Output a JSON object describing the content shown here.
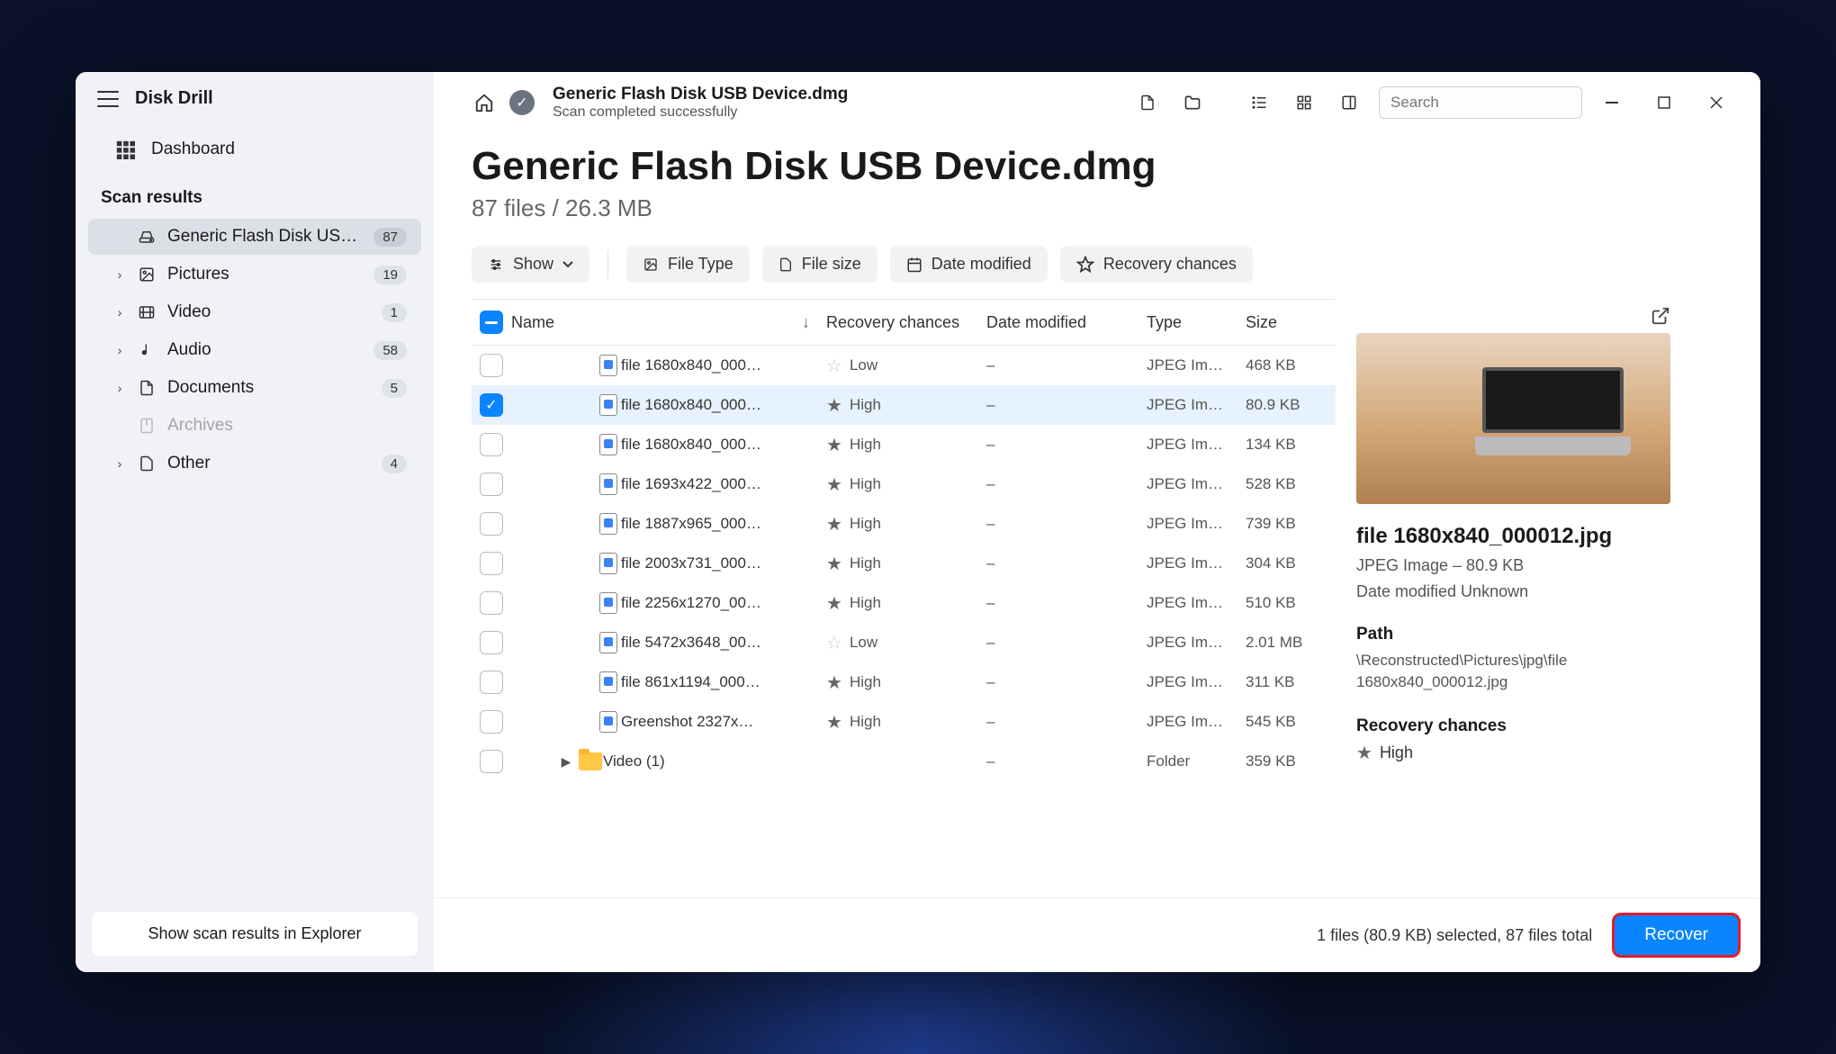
{
  "app_name": "Disk Drill",
  "sidebar": {
    "dashboard": "Dashboard",
    "section": "Scan results",
    "items": [
      {
        "label": "Generic Flash Disk USB D…",
        "badge": "87",
        "active": true,
        "icon": "drive",
        "chev": ""
      },
      {
        "label": "Pictures",
        "badge": "19",
        "icon": "pictures",
        "chev": "›"
      },
      {
        "label": "Video",
        "badge": "1",
        "icon": "video",
        "chev": "›"
      },
      {
        "label": "Audio",
        "badge": "58",
        "icon": "audio",
        "chev": "›"
      },
      {
        "label": "Documents",
        "badge": "5",
        "icon": "documents",
        "chev": "›"
      },
      {
        "label": "Archives",
        "badge": "",
        "icon": "archives",
        "chev": "",
        "disabled": true
      },
      {
        "label": "Other",
        "badge": "4",
        "icon": "other",
        "chev": "›"
      }
    ],
    "footer_btn": "Show scan results in Explorer"
  },
  "topbar": {
    "title": "Generic Flash Disk USB Device.dmg",
    "subtitle": "Scan completed successfully",
    "search_placeholder": "Search"
  },
  "heading": {
    "title": "Generic Flash Disk USB Device.dmg",
    "sub": "87 files / 26.3 MB"
  },
  "filters": {
    "show": "Show",
    "file_type": "File Type",
    "file_size": "File size",
    "date_modified": "Date modified",
    "recovery_chances": "Recovery chances"
  },
  "columns": {
    "name": "Name",
    "recovery": "Recovery chances",
    "date": "Date modified",
    "type": "Type",
    "size": "Size"
  },
  "rows": [
    {
      "name": "file 1680x840_000…",
      "rec": "Low",
      "rec_filled": false,
      "date": "–",
      "type": "JPEG Im…",
      "size": "468 KB",
      "selected": false
    },
    {
      "name": "file 1680x840_000…",
      "rec": "High",
      "rec_filled": true,
      "date": "–",
      "type": "JPEG Im…",
      "size": "80.9 KB",
      "selected": true
    },
    {
      "name": "file 1680x840_000…",
      "rec": "High",
      "rec_filled": true,
      "date": "–",
      "type": "JPEG Im…",
      "size": "134 KB",
      "selected": false
    },
    {
      "name": "file 1693x422_000…",
      "rec": "High",
      "rec_filled": true,
      "date": "–",
      "type": "JPEG Im…",
      "size": "528 KB",
      "selected": false
    },
    {
      "name": "file 1887x965_000…",
      "rec": "High",
      "rec_filled": true,
      "date": "–",
      "type": "JPEG Im…",
      "size": "739 KB",
      "selected": false
    },
    {
      "name": "file 2003x731_000…",
      "rec": "High",
      "rec_filled": true,
      "date": "–",
      "type": "JPEG Im…",
      "size": "304 KB",
      "selected": false
    },
    {
      "name": "file 2256x1270_00…",
      "rec": "High",
      "rec_filled": true,
      "date": "–",
      "type": "JPEG Im…",
      "size": "510 KB",
      "selected": false
    },
    {
      "name": "file 5472x3648_00…",
      "rec": "Low",
      "rec_filled": false,
      "date": "–",
      "type": "JPEG Im…",
      "size": "2.01 MB",
      "selected": false
    },
    {
      "name": "file 861x1194_000…",
      "rec": "High",
      "rec_filled": true,
      "date": "–",
      "type": "JPEG Im…",
      "size": "311 KB",
      "selected": false
    },
    {
      "name": "Greenshot 2327x…",
      "rec": "High",
      "rec_filled": true,
      "date": "–",
      "type": "JPEG Im…",
      "size": "545 KB",
      "selected": false
    }
  ],
  "folder_row": {
    "name": "Video (1)",
    "date": "–",
    "type": "Folder",
    "size": "359 KB"
  },
  "preview": {
    "title": "file 1680x840_000012.jpg",
    "meta": "JPEG Image – 80.9 KB",
    "date": "Date modified Unknown",
    "path_label": "Path",
    "path": "\\Reconstructed\\Pictures\\jpg\\file 1680x840_000012.jpg",
    "rec_label": "Recovery chances",
    "rec_value": "High"
  },
  "footer": {
    "status": "1 files (80.9 KB) selected, 87 files total",
    "recover": "Recover"
  }
}
